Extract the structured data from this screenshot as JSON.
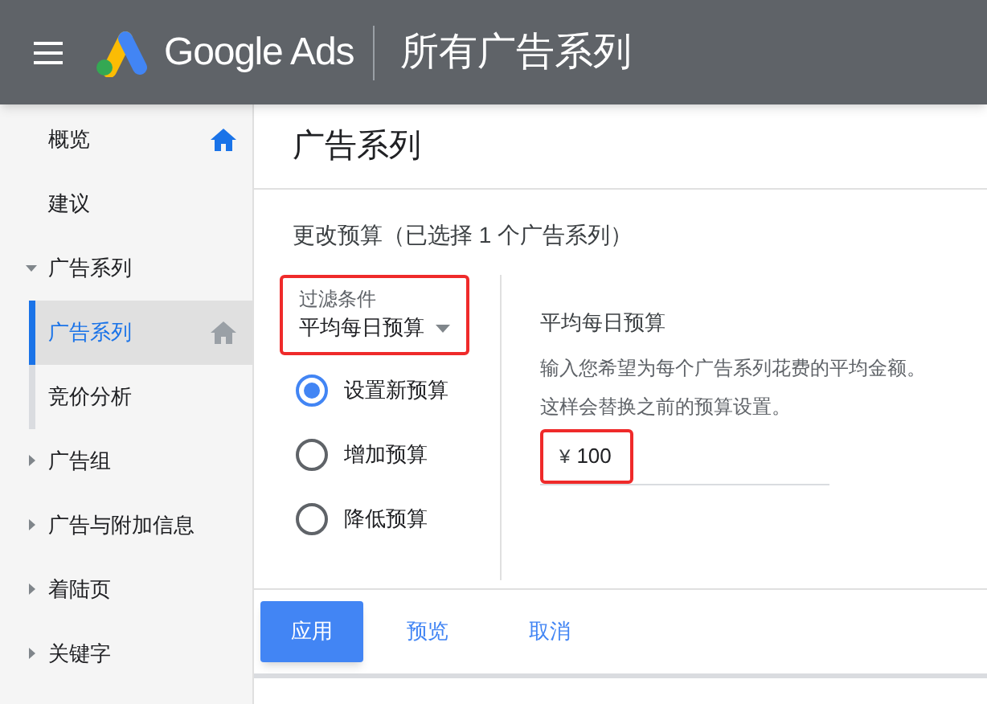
{
  "header": {
    "brand": "Google Ads",
    "title": "所有广告系列"
  },
  "sidebar": {
    "items": [
      {
        "label": "概览",
        "selected": false,
        "home_pinned": true
      },
      {
        "label": "建议",
        "selected": false
      },
      {
        "label": "广告系列",
        "selected": false,
        "expanded": true,
        "children": [
          {
            "label": "广告系列",
            "selected": true,
            "home_pinned": false
          },
          {
            "label": "竞价分析",
            "selected": false
          }
        ]
      },
      {
        "label": "广告组",
        "selected": false,
        "expanded": false
      },
      {
        "label": "广告与附加信息",
        "selected": false,
        "expanded": false
      },
      {
        "label": "着陆页",
        "selected": false,
        "expanded": false
      },
      {
        "label": "关键字",
        "selected": false,
        "expanded": false
      }
    ]
  },
  "page_title": "广告系列",
  "section_title": "更改预算（已选择 1 个广告系列）",
  "filter": {
    "label": "过滤条件",
    "value": "平均每日预算",
    "highlighted": true
  },
  "options": [
    {
      "label": "设置新预算",
      "selected": true
    },
    {
      "label": "增加预算",
      "selected": false
    },
    {
      "label": "降低预算",
      "selected": false
    }
  ],
  "budget": {
    "title": "平均每日预算",
    "description": [
      "输入您希望为每个广告系列花费的平均金额。",
      "这样会替换之前的预算设置。"
    ],
    "currency": "¥",
    "value": "100",
    "highlighted": true
  },
  "buttons": [
    {
      "label": "应用",
      "kind": "primary"
    },
    {
      "label": "预览",
      "kind": "text"
    },
    {
      "label": "取消",
      "kind": "text"
    }
  ]
}
